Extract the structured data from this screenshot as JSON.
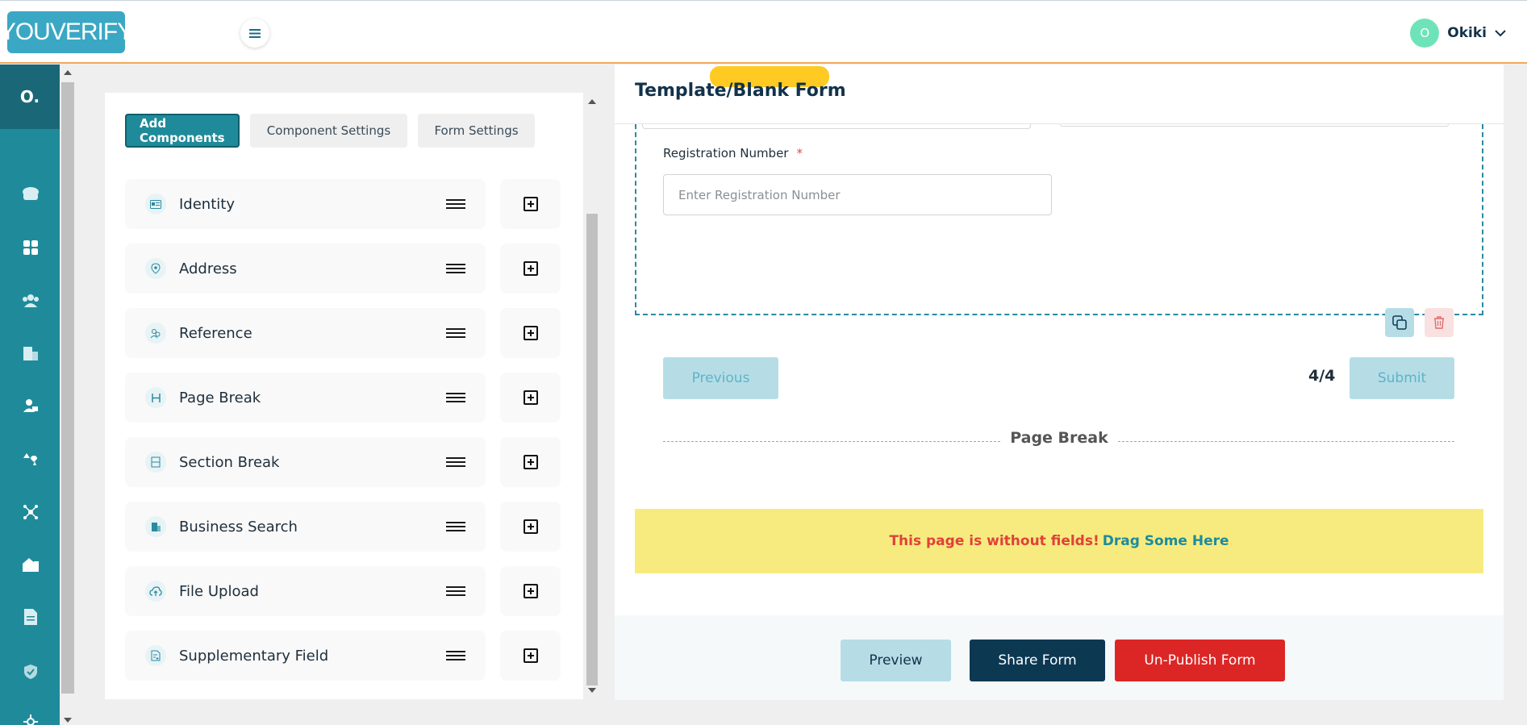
{
  "header": {
    "logo_text": "YOUVERIFY",
    "user_initial": "O",
    "username": "Okiki"
  },
  "rail": {
    "org_initial": "O.",
    "icons": [
      "dashboard-icon",
      "apps-icon",
      "users-icon",
      "building-icon",
      "user-card-icon",
      "scale-icon",
      "network-icon",
      "home-icon",
      "document-icon",
      "shield-icon",
      "settings-icon"
    ]
  },
  "components_panel": {
    "tabs": [
      {
        "label": "Add Components",
        "active": true
      },
      {
        "label": "Component Settings",
        "active": false
      },
      {
        "label": "Form Settings",
        "active": false
      }
    ],
    "items": [
      {
        "label": "Identity",
        "icon": "id-card-icon"
      },
      {
        "label": "Address",
        "icon": "location-pin-icon"
      },
      {
        "label": "Reference",
        "icon": "people-icon"
      },
      {
        "label": "Page Break",
        "icon": "page-break-icon"
      },
      {
        "label": "Section Break",
        "icon": "section-break-icon"
      },
      {
        "label": "Business Search",
        "icon": "building-icon"
      },
      {
        "label": "File Upload",
        "icon": "cloud-upload-icon"
      },
      {
        "label": "Supplementary Field",
        "icon": "doc-plus-icon"
      }
    ]
  },
  "form": {
    "title": "Template/Blank Form",
    "registration_label": "Registration Number",
    "required_mark": "*",
    "registration_placeholder": "Enter Registration Number",
    "previous_label": "Previous",
    "page_count": "4/4",
    "submit_label": "Submit",
    "page_break_label": "Page Break",
    "empty_warning": "This page is without fields!",
    "empty_cta": "Drag Some Here"
  },
  "footer": {
    "preview_label": "Preview",
    "share_label": "Share Form",
    "unpublish_label": "Un-Publish Form"
  },
  "colors": {
    "primary": "#1f8b9a",
    "navy": "#0c3852",
    "danger": "#dc2626",
    "warning_bg": "#f7eb7f"
  }
}
